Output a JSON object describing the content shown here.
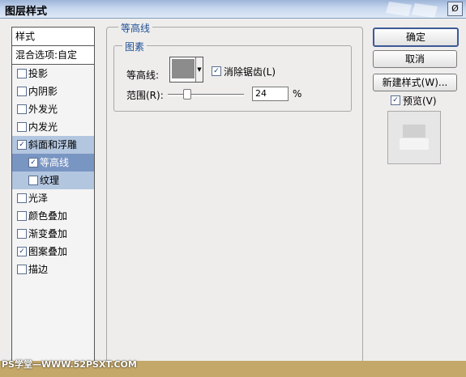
{
  "window": {
    "title": "图层样式",
    "close_glyph": "Ø"
  },
  "sidebar": {
    "header": "样式",
    "blend_options": "混合选项:自定",
    "items": [
      {
        "label": "投影",
        "checked": false
      },
      {
        "label": "内阴影",
        "checked": false
      },
      {
        "label": "外发光",
        "checked": false
      },
      {
        "label": "内发光",
        "checked": false
      },
      {
        "label": "斜面和浮雕",
        "checked": true
      },
      {
        "label": "等高线",
        "checked": true,
        "selected": true
      },
      {
        "label": "纹理",
        "checked": false
      },
      {
        "label": "光泽",
        "checked": false
      },
      {
        "label": "颜色叠加",
        "checked": false
      },
      {
        "label": "渐变叠加",
        "checked": false
      },
      {
        "label": "图案叠加",
        "checked": true
      },
      {
        "label": "描边",
        "checked": false
      }
    ],
    "check_glyph": "✓"
  },
  "panel": {
    "title": "等高线",
    "group_title": "图素",
    "contour_label": "等高线:",
    "anti_alias_label": "消除锯齿(L)",
    "anti_alias_checked": true,
    "range_label": "范围(R):",
    "range_value": "24",
    "range_unit": "%",
    "range_fraction": 0.24,
    "dropdown_arrow": "▼"
  },
  "buttons": {
    "ok": "确定",
    "cancel": "取消",
    "new_style": "新建样式(W)..."
  },
  "preview": {
    "label": "预览(V)",
    "checked": true
  },
  "watermark": "PS学堂—WWW.52PSXT.COM"
}
